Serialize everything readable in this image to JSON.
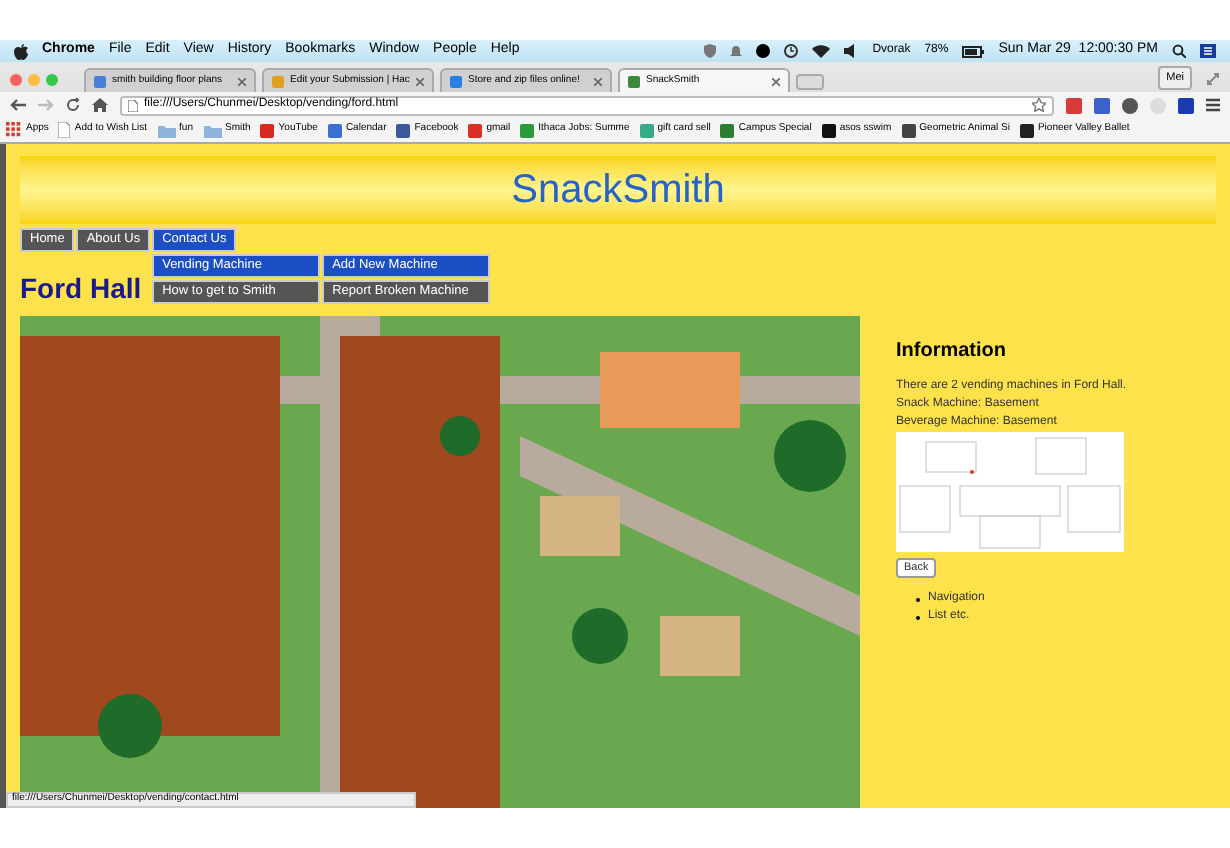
{
  "menu_bar": {
    "app": "Chrome",
    "menus": [
      "File",
      "Edit",
      "View",
      "History",
      "Bookmarks",
      "Window",
      "People",
      "Help"
    ],
    "keyboard": "Dvorak",
    "battery": "78%",
    "clock": "Sun Mar 29  12:00:30 PM"
  },
  "browser": {
    "tabs": [
      {
        "title": "smith building floor plans",
        "selected": false,
        "color": "#4a7fd6"
      },
      {
        "title": "Edit your Submission | Hac",
        "selected": false,
        "color": "#e0a020"
      },
      {
        "title": "Store and zip files online!",
        "selected": false,
        "color": "#2a7fe0"
      },
      {
        "title": "SnackSmith",
        "selected": true,
        "color": "#3a8a3a"
      }
    ],
    "profile": "Mei",
    "address": "file:///Users/Chunmei/Desktop/vending/ford.html",
    "bookmarks": [
      {
        "label": "Apps",
        "kind": "apps",
        "color": "#d04030"
      },
      {
        "label": "Add to Wish List",
        "kind": "page",
        "color": "#ffffff"
      },
      {
        "label": "fun",
        "kind": "folder",
        "color": "#8fb4dc"
      },
      {
        "label": "Smith",
        "kind": "folder",
        "color": "#8fb4dc"
      },
      {
        "label": "YouTube",
        "kind": "site",
        "color": "#d62a1e"
      },
      {
        "label": "Calendar",
        "kind": "site",
        "color": "#3b6fd0"
      },
      {
        "label": "Facebook",
        "kind": "site",
        "color": "#3b5998"
      },
      {
        "label": "gmail",
        "kind": "site",
        "color": "#d93025"
      },
      {
        "label": "Ithaca Jobs: Summe",
        "kind": "site",
        "color": "#2a9a3a"
      },
      {
        "label": "gift card sell",
        "kind": "site",
        "color": "#3aa88a"
      },
      {
        "label": "Campus Special",
        "kind": "site",
        "color": "#2e7d32"
      },
      {
        "label": "asos sswim",
        "kind": "site",
        "color": "#111111"
      },
      {
        "label": "Geometric Animal Si",
        "kind": "site",
        "color": "#444444"
      },
      {
        "label": "Pioneer Valley Ballet",
        "kind": "site",
        "color": "#222222"
      }
    ]
  },
  "page": {
    "site_title": "SnackSmith",
    "nav": [
      {
        "label": "Home",
        "selected": false
      },
      {
        "label": "About Us",
        "selected": false
      },
      {
        "label": "Contact Us",
        "selected": true
      }
    ],
    "dropdown": [
      {
        "label": "Vending Machine",
        "highlighted": true
      },
      {
        "label": "Add New Machine",
        "highlighted": true
      },
      {
        "label": "How to get to Smith",
        "highlighted": false
      },
      {
        "label": "Report Broken Machine",
        "highlighted": false
      }
    ],
    "heading": "Ford Hall",
    "info": {
      "title": "Information",
      "lines": [
        "There are 2 vending machines in Ford Hall.",
        "Snack Machine: Basement",
        "Beverage Machine: Basement"
      ],
      "back_button": "Back",
      "list": [
        "Navigation",
        "List etc."
      ]
    }
  },
  "status_url": "file:///Users/Chunmei/Desktop/vending/contact.html"
}
